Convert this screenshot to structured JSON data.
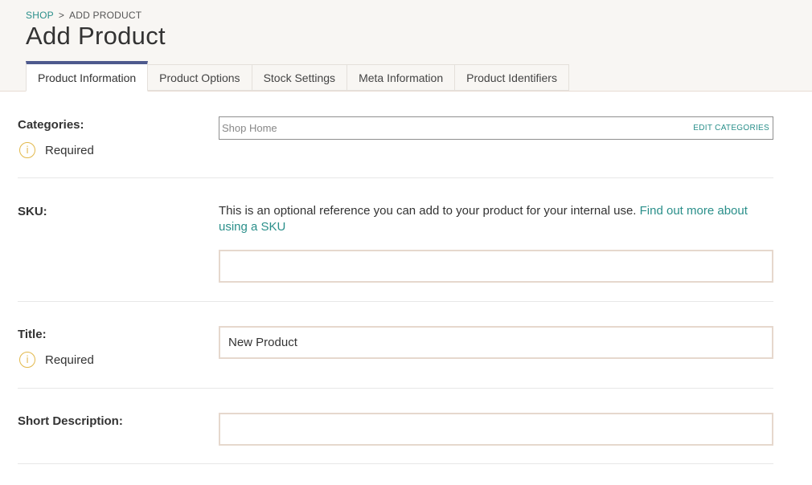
{
  "breadcrumb": {
    "shop": "SHOP",
    "separator": ">",
    "current": "ADD PRODUCT"
  },
  "page": {
    "title": "Add Product"
  },
  "tabs": [
    {
      "label": "Product Information",
      "active": true
    },
    {
      "label": "Product Options"
    },
    {
      "label": "Stock Settings"
    },
    {
      "label": "Meta Information"
    },
    {
      "label": "Product Identifiers"
    }
  ],
  "form": {
    "categories": {
      "label": "Categories:",
      "required": "Required",
      "value": "Shop Home",
      "edit_label": "EDIT CATEGORIES"
    },
    "sku": {
      "label": "SKU:",
      "help": "This is an optional reference you can add to your product for your internal use.",
      "help_link": "Find out more about using a SKU",
      "value": ""
    },
    "title": {
      "label": "Title:",
      "required": "Required",
      "value": "New Product"
    },
    "short_description": {
      "label": "Short Description:",
      "value": ""
    }
  },
  "icons": {
    "info": "i"
  },
  "colors": {
    "accent_teal": "#2a8f8a",
    "tab_active_border": "#4e5a8e",
    "required_icon": "#e2b84a"
  }
}
